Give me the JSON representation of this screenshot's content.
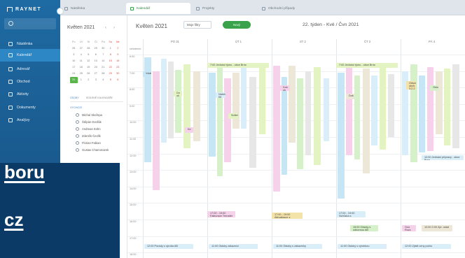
{
  "app": {
    "brand": "RAYNET"
  },
  "sidebar": {
    "items": [
      {
        "label": "Nástěnka",
        "active": false
      },
      {
        "label": "Kalendář",
        "active": true
      },
      {
        "label": "Adresář",
        "active": false
      },
      {
        "label": "Obchod",
        "active": false
      },
      {
        "label": "Aktivity",
        "active": false
      },
      {
        "label": "Dokumenty",
        "active": false
      },
      {
        "label": "Analýzy",
        "active": false
      }
    ]
  },
  "tabs": [
    {
      "label": "Nástěnka",
      "active": false
    },
    {
      "label": "Kalendář",
      "active": true
    },
    {
      "label": "Projekty",
      "active": false
    },
    {
      "label": "Obchodní případy",
      "active": false
    }
  ],
  "mini_calendar": {
    "title": "Květen 2021",
    "weekday_headers": [
      "Po",
      "Út",
      "St",
      "Čt",
      "Pá",
      "So",
      "Ne"
    ],
    "weeks": [
      [
        "26",
        "27",
        "28",
        "29",
        "30",
        "1",
        "2"
      ],
      [
        "3",
        "4",
        "5",
        "6",
        "7",
        "8",
        "9"
      ],
      [
        "10",
        "11",
        "12",
        "13",
        "14",
        "15",
        "16"
      ],
      [
        "17",
        "18",
        "19",
        "20",
        "21",
        "22",
        "23"
      ],
      [
        "24",
        "25",
        "26",
        "27",
        "28",
        "29",
        "30"
      ],
      [
        "31",
        "1",
        "2",
        "3",
        "4",
        "5",
        "6"
      ]
    ],
    "list_tabs": [
      "OSOBY",
      "SDÍLENÉ KALENDÁŘE"
    ],
    "group": "VÝCHOZÍ",
    "people": [
      "Michal Skořepa",
      "Štěpán Dvořák",
      "Andreas Kühn",
      "Zdeněk Čevlík",
      "Florian Fabian",
      "Gustav Chamorazek"
    ]
  },
  "calendar": {
    "filter_label": "Moje filtry",
    "create_label": "Nový",
    "week_title": "22. týden - Kvě / Čvn 2021",
    "days": [
      "PO 31",
      "ÚT 1",
      "ST 2",
      "ČT 3",
      "PÁ 4"
    ],
    "allday_label": "celodenní",
    "times": [
      "6:00",
      "7:00",
      "8:00",
      "9:00",
      "10:00",
      "11:00",
      "12:00",
      "13:00",
      "14:00",
      "15:00",
      "16:00",
      "17:00",
      "18:00"
    ],
    "events": [
      {
        "day": 1,
        "label": "7:00 Jednání týmu - obce Brno"
      },
      {
        "day": 3,
        "label": "7:00 Jednání týmu - obce Brno"
      },
      {
        "day": 0,
        "label": "Volat"
      },
      {
        "day": 0,
        "label": "Do ok"
      },
      {
        "day": 0,
        "label": "Ke"
      },
      {
        "day": 1,
        "label": "Náleh Kli"
      },
      {
        "day": 1,
        "label": "Sdílet"
      },
      {
        "day": 2,
        "label": "Dok ok"
      },
      {
        "day": 3,
        "label": "Dok"
      },
      {
        "day": 4,
        "label": "Odsouhlas obch. 3.2.2"
      },
      {
        "day": 4,
        "label": "Oslo"
      },
      {
        "day": 4,
        "label": "12:00 Jednání přípravy - obce Brno"
      },
      {
        "day": 1,
        "label": "17:00 - 19:00 Fakturace Trenatér"
      },
      {
        "day": 2,
        "label": "17:00 - 19:00 Aktualizace s"
      },
      {
        "day": 3,
        "label": "17:00 - 19:00 Schůzka s"
      },
      {
        "day": 3,
        "label": "15:00 Otázky s odbornou AB"
      },
      {
        "day": 4,
        "label": "Ooo Rozc"
      },
      {
        "day": 4,
        "label": "12:00 2:00 Zpr. ostat"
      },
      {
        "day": 0,
        "label": "12:00 Porady s výroba AB"
      },
      {
        "day": 1,
        "label": "11:00 Otázky zákazníci"
      },
      {
        "day": 2,
        "label": "11:00 Otázky s zákazníky"
      },
      {
        "day": 3,
        "label": "11:00 Otázky s výrobkou"
      },
      {
        "day": 4,
        "label": "12:00 Zjistit ceny počtu"
      }
    ]
  },
  "overlay": {
    "line1": "boru",
    "line2": "cz"
  }
}
